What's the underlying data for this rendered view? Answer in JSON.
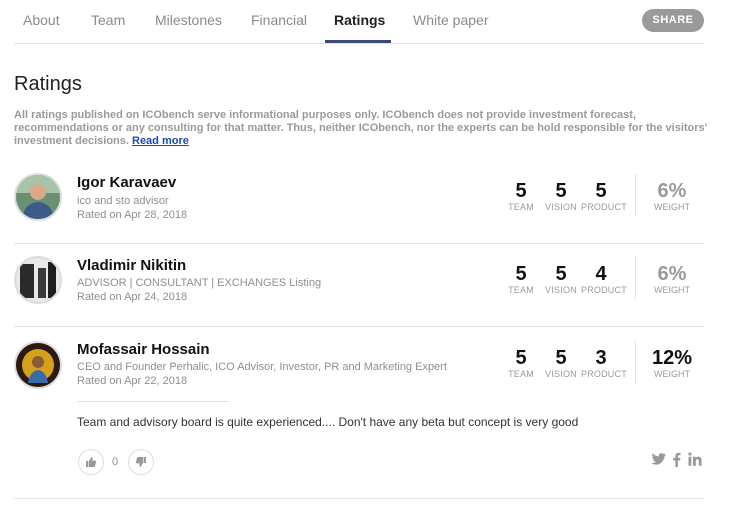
{
  "tabs": [
    {
      "label": "About"
    },
    {
      "label": "Team"
    },
    {
      "label": "Milestones"
    },
    {
      "label": "Financial"
    },
    {
      "label": "Ratings",
      "active": true
    },
    {
      "label": "White paper"
    }
  ],
  "share_label": "SHARE",
  "page_title": "Ratings",
  "disclaimer": {
    "text": "All ratings published on ICObench serve informational purposes only. ICObench does not provide investment forecast, recommendations or any consulting for that matter. Thus, neither ICObench, nor the experts can be hold responsible for the visitors' investment decisions.",
    "link": "Read more"
  },
  "score_labels": {
    "team": "TEAM",
    "vision": "VISION",
    "product": "PRODUCT",
    "weight": "WEIGHT"
  },
  "ratings": [
    {
      "name": "Igor Karavaev",
      "role": "ico and sto advisor",
      "date": "Rated on Apr 28, 2018",
      "team": "5",
      "vision": "5",
      "product": "5",
      "weight": "6%"
    },
    {
      "name": "Vladimir Nikitin",
      "role": "ADVISOR | CONSULTANT | EXCHANGES Listing",
      "date": "Rated on Apr 24, 2018",
      "team": "5",
      "vision": "5",
      "product": "4",
      "weight": "6%"
    },
    {
      "name": "Mofassair Hossain",
      "role": "CEO and Founder Perhalic, ICO Advisor, Investor, PR and Marketing Expert",
      "date": "Rated on Apr 22, 2018",
      "team": "5",
      "vision": "5",
      "product": "3",
      "weight": "12%",
      "review": "Team and advisory board is quite experienced.... Don't have any beta but concept is very good",
      "votes": "0"
    }
  ],
  "icons": {
    "thumbs_up": "thumbs-up-icon",
    "thumbs_down": "thumbs-down-icon",
    "twitter": "twitter-icon",
    "facebook": "facebook-icon",
    "linkedin": "linkedin-icon"
  },
  "colors": {
    "accent": "#3d4a79",
    "link": "#1c4ab5",
    "share_bg": "#9a9a9a",
    "muted": "#9a9a9a"
  }
}
